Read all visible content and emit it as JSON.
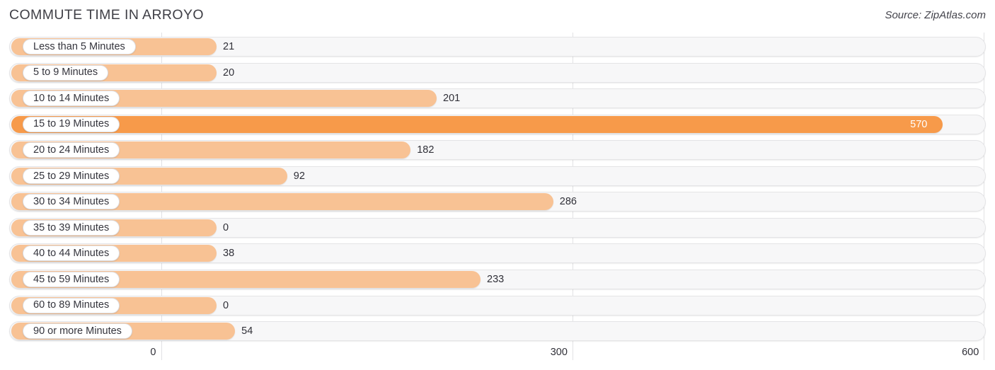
{
  "header": {
    "title": "COMMUTE TIME IN ARROYO",
    "source": "Source: ZipAtlas.com"
  },
  "colors": {
    "bar_light": "#f8c294",
    "bar_highlight": "#f79a4a",
    "track_fill": "#f7f7f8",
    "track_border": "#e4e4e6",
    "gridline": "#e2e2e4",
    "text": "#303038",
    "value_in_bar": "#ffffff"
  },
  "chart_data": {
    "type": "bar",
    "orientation": "horizontal",
    "title": "COMMUTE TIME IN ARROYO",
    "xlabel": "",
    "ylabel": "",
    "xlim": [
      0,
      600
    ],
    "ticks": [
      0,
      300,
      600
    ],
    "tick_labels": [
      "0",
      "300",
      "600"
    ],
    "grid": true,
    "legend": false,
    "highlight_category": "15 to 19 Minutes",
    "categories": [
      "Less than 5 Minutes",
      "5 to 9 Minutes",
      "10 to 14 Minutes",
      "15 to 19 Minutes",
      "20 to 24 Minutes",
      "25 to 29 Minutes",
      "30 to 34 Minutes",
      "35 to 39 Minutes",
      "40 to 44 Minutes",
      "45 to 59 Minutes",
      "60 to 89 Minutes",
      "90 or more Minutes"
    ],
    "values": [
      21,
      20,
      201,
      570,
      182,
      92,
      286,
      0,
      38,
      233,
      0,
      54
    ],
    "value_labels": [
      "21",
      "20",
      "201",
      "570",
      "182",
      "92",
      "286",
      "0",
      "38",
      "233",
      "0",
      "54"
    ]
  }
}
